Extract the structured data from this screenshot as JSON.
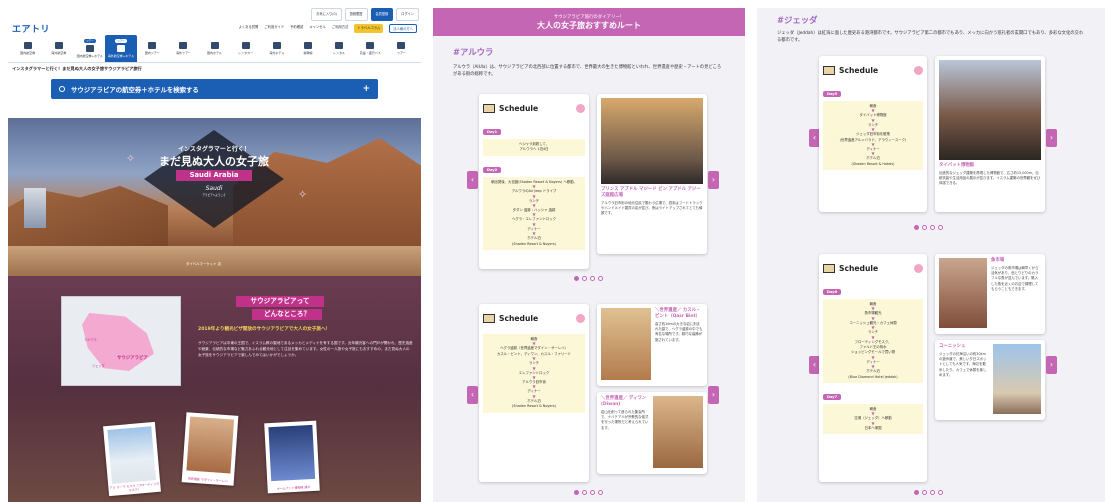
{
  "colors": {
    "brand_blue": "#1a5fb4",
    "accent_magenta": "#c466b4",
    "area_purple": "#a36ac2",
    "pink": "#c0328a"
  },
  "header": {
    "top_buttons": [
      "お気に入り(0)",
      "旅程履歴",
      "会員登録",
      "ログイン"
    ],
    "logo": "エアトリ",
    "links": [
      "よくある質問",
      "ご利用ガイド",
      "予約確認",
      "キャンセル",
      "ご利用方法"
    ],
    "link_hl": "トラベルコラム",
    "link_ol": "法人様の方へ"
  },
  "nav": [
    {
      "label": "国内航空券",
      "pill": ""
    },
    {
      "label": "海外航空券",
      "pill": ""
    },
    {
      "label": "国内航空券+ホテル",
      "pill": "ツアー"
    },
    {
      "label": "海外航空券+ホテル",
      "pill": "ツアー",
      "active": true
    },
    {
      "label": "国内ツアー",
      "pill": ""
    },
    {
      "label": "海外ツアー",
      "pill": ""
    },
    {
      "label": "国内ホテル",
      "pill": ""
    },
    {
      "label": "レンタカー",
      "pill": ""
    },
    {
      "label": "海外ホテル",
      "pill": ""
    },
    {
      "label": "新幹線",
      "pill": ""
    },
    {
      "label": "レンタル",
      "pill": ""
    },
    {
      "label": "高速・夜行バス",
      "pill": ""
    },
    {
      "label": "ツアー",
      "pill": ""
    }
  ],
  "breadcrumb": "インスタグラマーと行く！まだ見ぬ大人の女子旅サウジアラビア旅行",
  "search_label": "サウジアラビアの航空券＋ホテルを検索する",
  "hero": {
    "line1": "インスタグラマーと行く！",
    "line2": "まだ見ぬ大人の女子旅",
    "line3": "Saudi Arabia",
    "logo": "Saudi",
    "logo_sub": "アラビアへようこそ",
    "caption": "タイベルマーケット 店"
  },
  "intro": {
    "title1": "サウジアラビアって",
    "title2": "どんなところ？",
    "lead": "2019年より観光ビザ開放のサウジアラビアで大人の女子旅へ！",
    "body": "サウジアラビアは中東の王国で、イスラム教の聖地であるメッカとメディナを有する国です。近年観光客への門戸が開かれ、歴史遺産や絶景、伝統的な市場など魅力あふれる観光地として注目を集めています。女性の一人旅や女子旅にもおすすめの、まだ見ぬ大人の女子旅をサウジアラビアで楽しんでみてはいかがでしょうか。",
    "map_label": "サウジアラビア",
    "map_city1": "ジェッダ",
    "map_city2": "アルウラ",
    "photos": [
      "アル ラーマ モスク（フローティングモスク）",
      "世界遺産 マダイン・サーレハ",
      "ホームアート博物館 展示"
    ]
  },
  "route": {
    "subtitle": "サウジアラビア旅行のダイアリー！",
    "title": "大人の女子旅おすすめルート"
  },
  "alula": {
    "area": "#アルウラ",
    "desc": "アルウラ（AlUla）は、サウジアラビアの北西部に位置する都市で、世界最大の生きた博物館といわれ、世界遺産や歴史・アートの見どころがある街の総称です。",
    "schedule_title": "Schedule",
    "card1": {
      "days": [
        {
          "day": "Day1",
          "items": [
            "ヘジャラ到着して、",
            "アルウラへ 1泊4日"
          ]
        },
        {
          "day": "Day2",
          "items": [
            "朝出発後、大賞館(Shaden Resort & Noyers) へ移動、",
            "アルウラのAir Jeep ドライブ",
            "ランチ",
            "タダン 遺跡・ハッシャ 遺跡",
            "ヘグラ・エレファントロック",
            "ディナー",
            "ホテル泊",
            "(Shaden Resort & Noyers)"
          ]
        }
      ],
      "photo_title": "プリンス アブドル マジード ビン アブドル アジーズ庭館広場",
      "photo_text": "アルウラ旧市街の地元住民で賑わう広場で、週末はフードトラックやハンドメイド雑貨の店が並び、夜はライトアップされてとても綺麗です。"
    },
    "card2": {
      "days": [
        {
          "day": "",
          "items": [
            "朝食",
            "ヘグラ遺跡（世界遺産マダイン・サーレハ）",
            "カスル・ビント、ディワン、カスル・ファリード",
            "ランチ",
            "エレファントロック",
            "アルウラ旧市街",
            "ディナー",
            "ホテル泊",
            "(Shaden Resort & Noyers)"
          ]
        }
      ],
      "photo1_title": "＼世界遺産／ カスル・ビント（Qasr Bint）",
      "photo1_text": "高さ約16mの大きな岩に刻まれた墓で、ヘグラ遺跡の中でも有名な場所です。精巧な装飾が施されています。",
      "photo2_title": "＼世界遺産／ ディワン(Diwan)",
      "photo2_text": "岩山を削って造られた集会所で、ナバテア人が宗教的な儀式を行った場所だと考えられています。"
    }
  },
  "jeddah": {
    "area": "#ジェッダ",
    "desc": "ジェッダ（Jeddah）は紅海に面した歴史ある港湾都市です。サウジアラビア第二の都市でもあり、メッカに向かう巡礼者の玄関口でもあり、多彩な文化の交わる都市です。",
    "schedule_title": "Schedule",
    "card1": {
      "days": [
        {
          "day": "Day5",
          "items": [
            "朝食",
            "タイバット博物館",
            "ランチ",
            "ジェッダ旧市街を散策",
            "(世界遺産アル＝バラド、アラウィースーク)",
            "ディナー",
            "ホテル泊",
            "(Shaden Resort & Hotels)"
          ]
        }
      ],
      "photo_title": "タイバット博物館",
      "photo_text": "伝統的なジェッダ建築を再現した博物館で、広さ約15,000m。伝統衣装や生活用品の展示が並びます。イスラム建築の世界観をぜひ体感できる。"
    },
    "card2": {
      "days": [
        {
          "day": "Day6",
          "items": [
            "朝食",
            "魚市場観光",
            "コーニッシュ観光・カフェ休憩",
            "ランチ",
            "フローティングモスク、",
            "ファルド王の噴水",
            "ショッピングモールで買い物",
            "ディナー",
            "ホテル泊",
            "(Blue Diamond Hotel Jeddah)"
          ]
        },
        {
          "day": "Day7",
          "items": [
            "朝食",
            "空港（ジェッダ）へ移動",
            "日本へ帰国"
          ]
        }
      ],
      "photo1_title": "魚市場",
      "photo1_text": "ジェッダの魚市場は朝早くから活気があり、色とりどりのカラフルな魚が並んでいます。購入した魚を近くのお店で調理してもらうこともできます。",
      "photo2_title": "コーニッシュ",
      "photo2_text": "ジェッダの紅海沿いの約30kmの遊歩道で、美しい夕日スポットとしても人気です。海辺を散歩したり、カフェで休憩を楽しめます。"
    }
  }
}
